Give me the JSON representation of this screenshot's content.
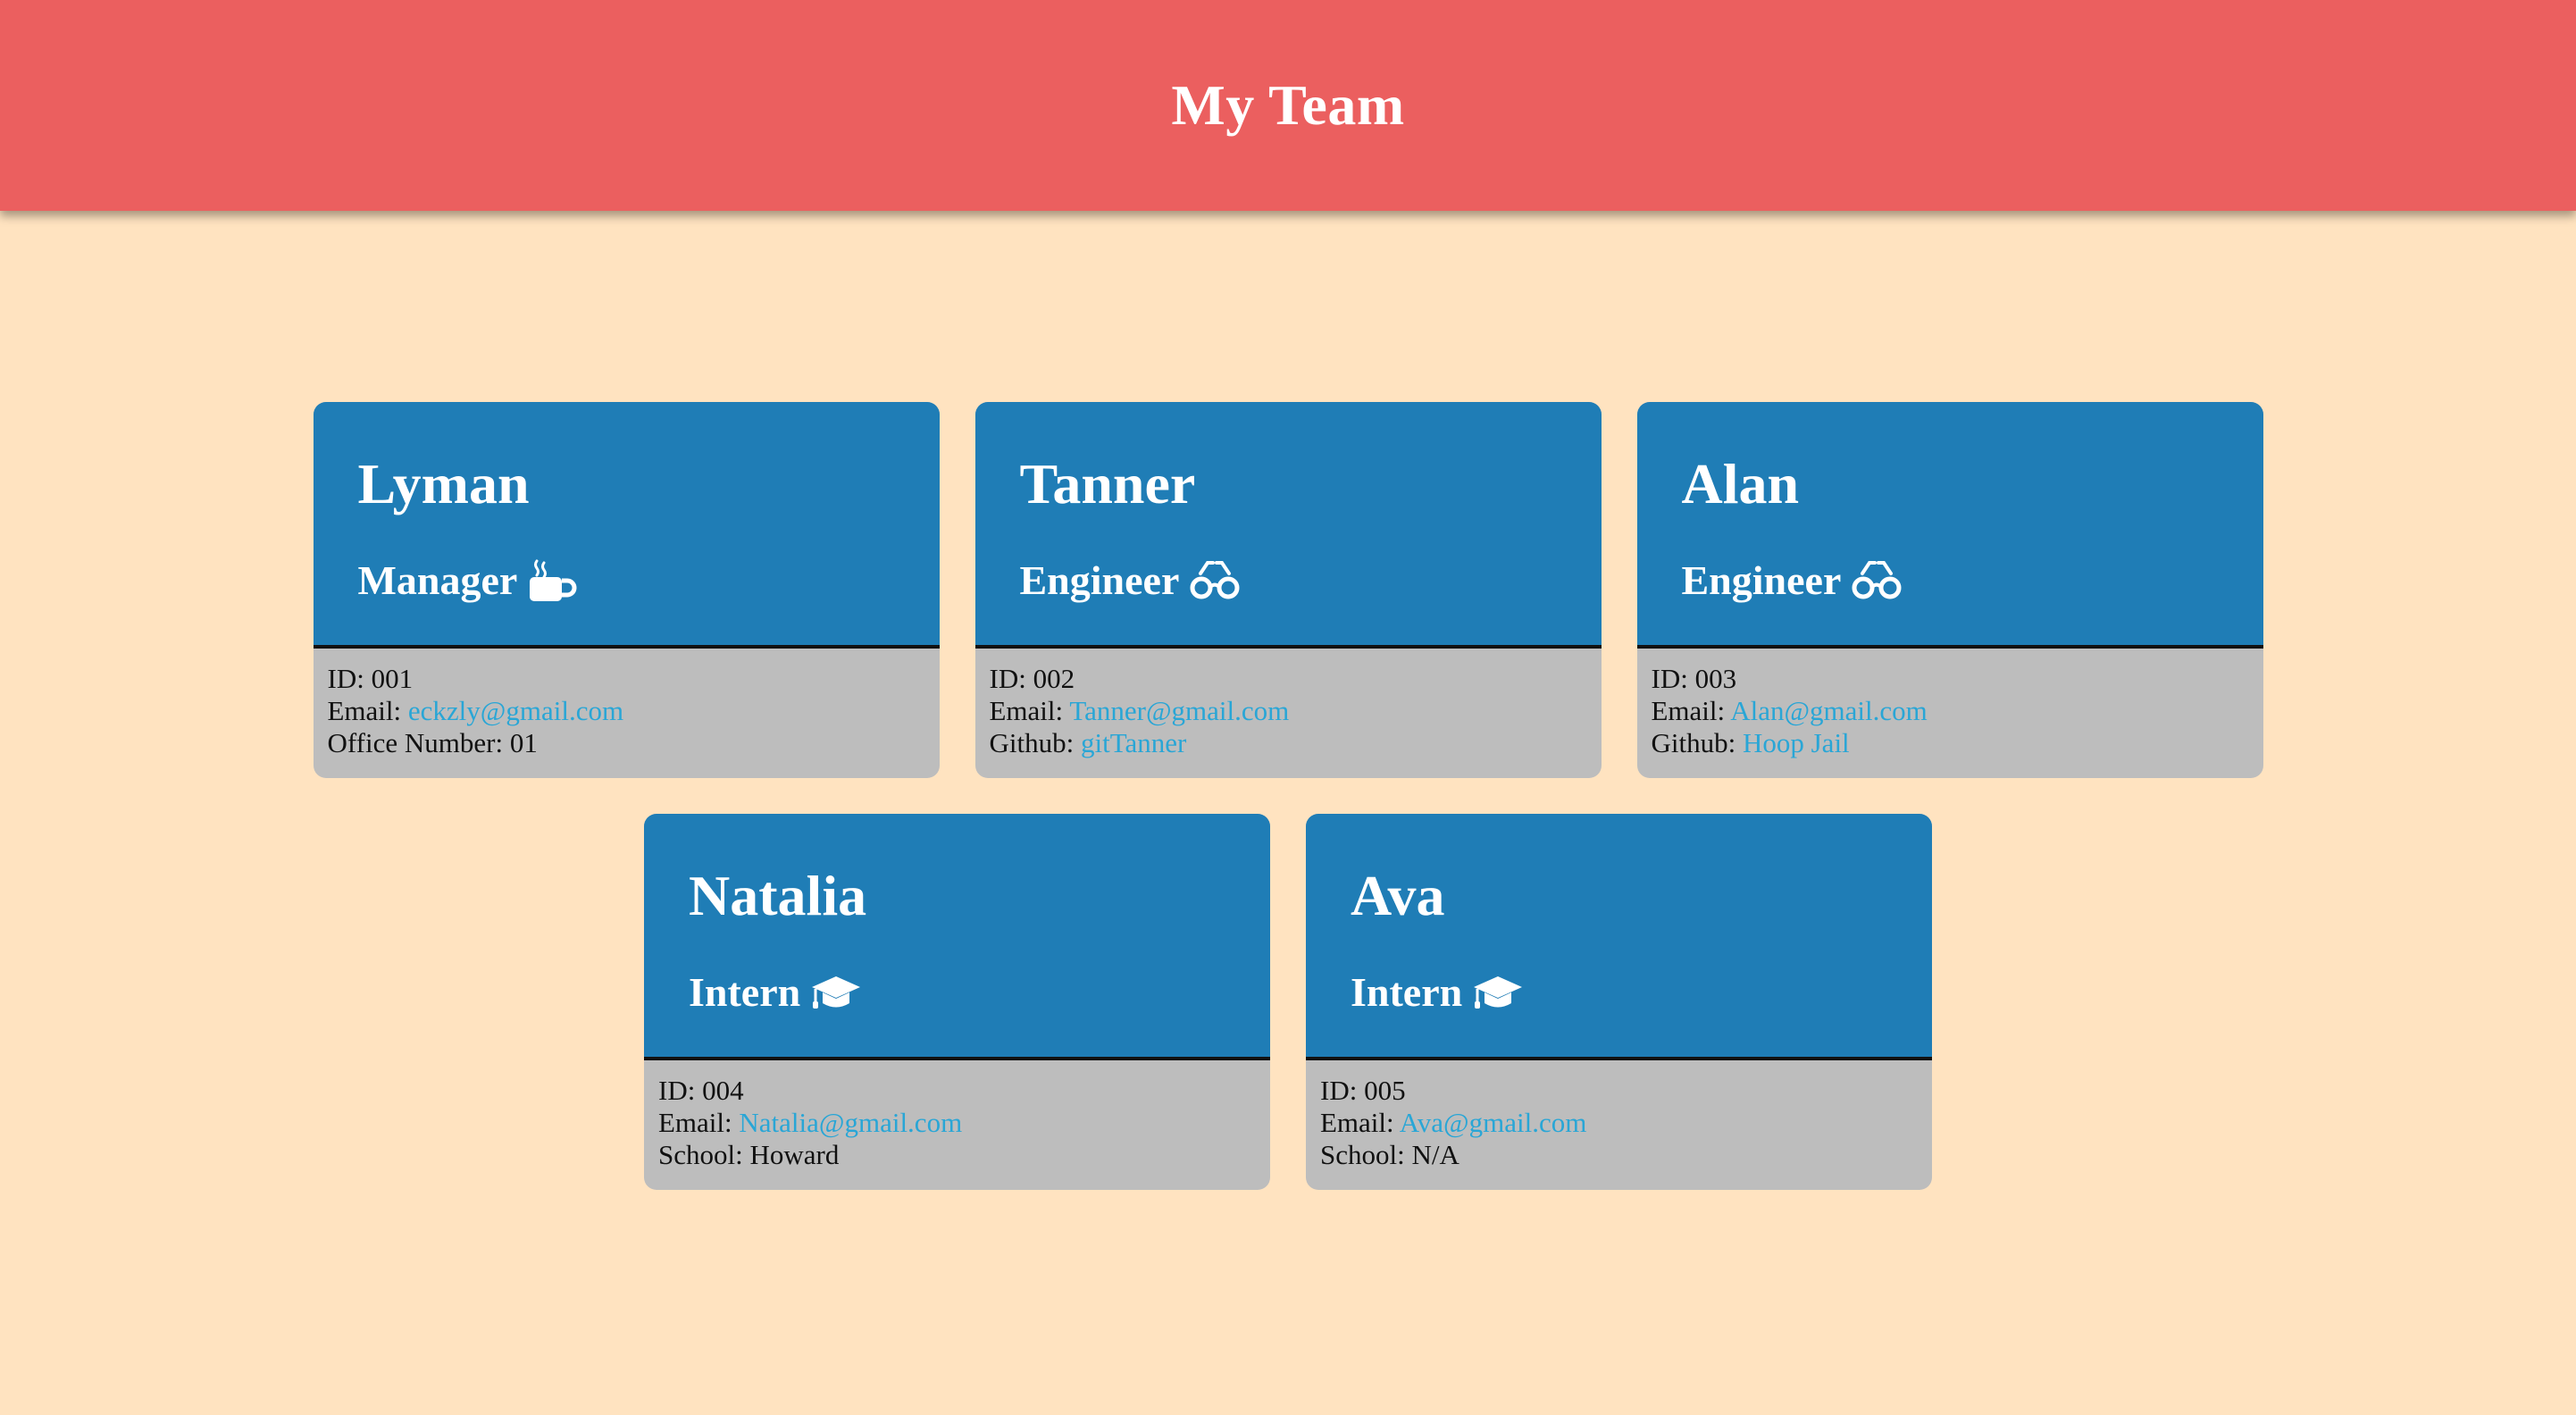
{
  "header": {
    "title": "My Team"
  },
  "colors": {
    "header_bg": "#eb5f5f",
    "page_bg": "#ffe3c0",
    "card_head_bg": "#1f7db6",
    "card_body_bg": "#bdbdbd",
    "link": "#29a6d6"
  },
  "team": [
    {
      "name": "Lyman",
      "role": "Manager",
      "role_icon": "coffee-mug-icon",
      "id_label": "ID:",
      "id": "001",
      "email_label": "Email:",
      "email": "eckzly@gmail.com",
      "extra_label": "Office Number:",
      "extra_value": "01"
    },
    {
      "name": "Tanner",
      "role": "Engineer",
      "role_icon": "glasses-icon",
      "id_label": "ID:",
      "id": "002",
      "email_label": "Email:",
      "email": "Tanner@gmail.com",
      "extra_label": "Github:",
      "extra_value": "gitTanner"
    },
    {
      "name": "Alan",
      "role": "Engineer",
      "role_icon": "glasses-icon",
      "id_label": "ID:",
      "id": "003",
      "email_label": "Email:",
      "email": "Alan@gmail.com",
      "extra_label": "Github:",
      "extra_value": "Hoop Jail"
    },
    {
      "name": "Natalia",
      "role": "Intern",
      "role_icon": "graduation-cap-icon",
      "id_label": "ID:",
      "id": "004",
      "email_label": "Email:",
      "email": "Natalia@gmail.com",
      "extra_label": "School:",
      "extra_value": "Howard"
    },
    {
      "name": "Ava",
      "role": "Intern",
      "role_icon": "graduation-cap-icon",
      "id_label": "ID:",
      "id": "005",
      "email_label": "Email:",
      "email": "Ava@gmail.com",
      "extra_label": "School:",
      "extra_value": "N/A"
    }
  ]
}
